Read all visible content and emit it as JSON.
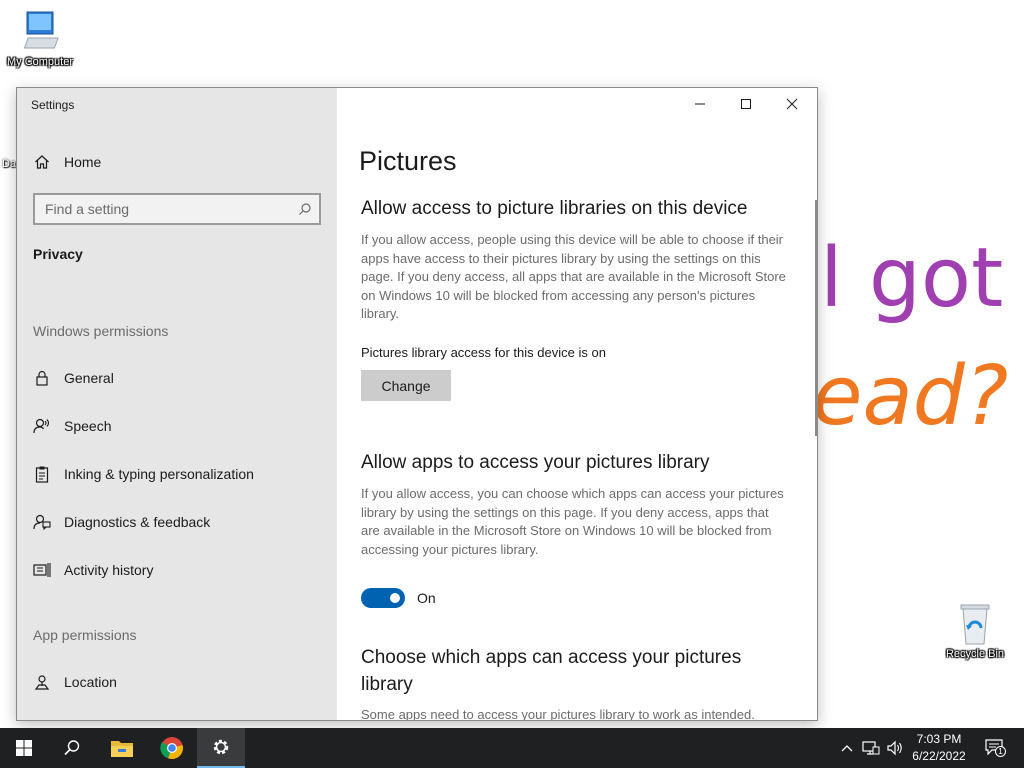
{
  "desktop": {
    "icons": {
      "my_computer": "My Computer",
      "recycle_bin": "Recycle Bin"
    },
    "stray_label": "Da",
    "wallpaper_line1": "l got",
    "wallpaper_line2": "ead?",
    "wallpaper_colors": {
      "line1": "#a040b0",
      "line2": "#f07820"
    }
  },
  "window": {
    "title": "Settings",
    "controls": {
      "minimize": "minimize-icon",
      "maximize": "maximize-icon",
      "close": "close-icon"
    }
  },
  "sidebar": {
    "home_label": "Home",
    "search_placeholder": "Find a setting",
    "privacy_heading": "Privacy",
    "windows_permissions_label": "Windows permissions",
    "windows_permissions_items": [
      {
        "label": "General",
        "icon": "lock-icon"
      },
      {
        "label": "Speech",
        "icon": "speech-icon"
      },
      {
        "label": "Inking & typing personalization",
        "icon": "inking-icon"
      },
      {
        "label": "Diagnostics & feedback",
        "icon": "diagnostics-icon"
      },
      {
        "label": "Activity history",
        "icon": "activity-history-icon"
      }
    ],
    "app_permissions_label": "App permissions",
    "app_permissions_items": [
      {
        "label": "Location",
        "icon": "location-icon"
      }
    ]
  },
  "content": {
    "page_title": "Pictures",
    "section1": {
      "heading": "Allow access to picture libraries on this device",
      "description": "If you allow access, people using this device will be able to choose if their apps have access to their pictures library by using the settings on this page. If you deny access, all apps that are available in the Microsoft Store on Windows 10 will be blocked from accessing any person's pictures library.",
      "status": "Pictures library access for this device is on",
      "button_label": "Change"
    },
    "section2": {
      "heading": "Allow apps to access your pictures library",
      "description": "If you allow access, you can choose which apps can access your pictures library by using the settings on this page. If you deny access, apps that are available in the Microsoft Store on Windows 10 will be blocked from accessing your pictures library.",
      "toggle_label": "On",
      "toggle_on": true
    },
    "section3": {
      "heading": "Choose which apps can access your pictures library",
      "description": "Some apps need to access your pictures library to work as intended."
    }
  },
  "taskbar": {
    "apps": [
      "start-icon",
      "search-icon",
      "file-explorer-icon",
      "chrome-icon",
      "settings-icon"
    ],
    "active_app": "settings-icon",
    "tray_icons": [
      "chevron-up-icon",
      "network-icon",
      "volume-icon"
    ],
    "time": "7:03 PM",
    "date": "6/22/2022",
    "notification_count": "1"
  },
  "colors": {
    "accent": "#0063b1",
    "sidebar_bg": "#e6e6e6",
    "taskbar_bg": "#1f2021"
  }
}
